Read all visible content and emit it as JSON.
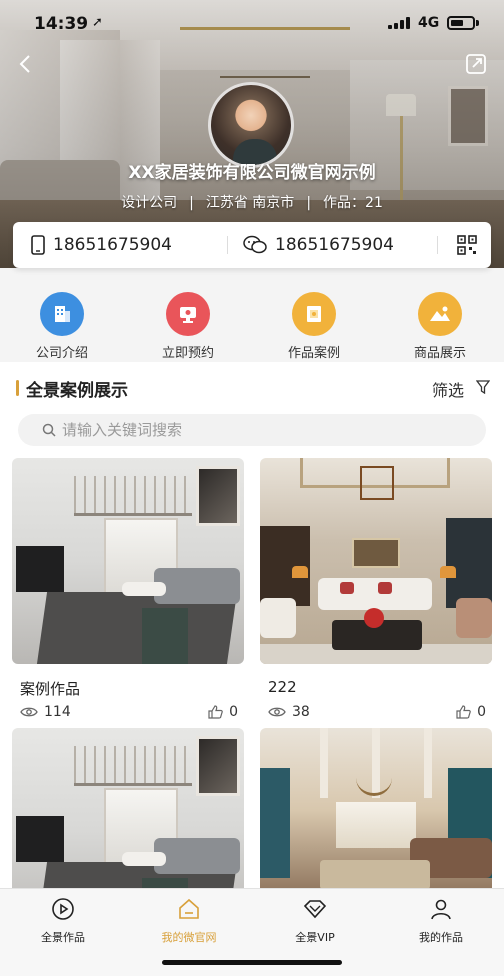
{
  "status_bar": {
    "time": "14:39",
    "location_glyph": "➚",
    "network": "4G"
  },
  "company": {
    "name": "XX家居装饰有限公司微官网示例",
    "type": "设计公司",
    "region": "江苏省 南京市",
    "works_label": "作品：21",
    "separator": "|"
  },
  "contact": {
    "phone": "18651675904",
    "wechat": "18651675904"
  },
  "menu": {
    "items": [
      {
        "label": "公司介绍",
        "color": "#3d8fe0"
      },
      {
        "label": "立即预约",
        "color": "#e9555a"
      },
      {
        "label": "作品案例",
        "color": "#f1b23b"
      },
      {
        "label": "商品展示",
        "color": "#f1b23b"
      }
    ]
  },
  "section": {
    "title": "全景案例展示",
    "filter_label": "筛选",
    "accent": "#d8a03a"
  },
  "search": {
    "placeholder": "请输入关键词搜索"
  },
  "cases": [
    {
      "title": "案例作品",
      "views": "114",
      "likes": "0"
    },
    {
      "title": "222",
      "views": "38",
      "likes": "0"
    }
  ],
  "tabbar": {
    "items": [
      {
        "label": "全景作品",
        "icon": "play-circle-icon",
        "active": false
      },
      {
        "label": "我的微官网",
        "icon": "home-icon",
        "active": true
      },
      {
        "label": "全景VIP",
        "icon": "diamond-icon",
        "active": false
      },
      {
        "label": "我的作品",
        "icon": "person-icon",
        "active": false
      }
    ],
    "active_color": "#d8a03a"
  }
}
